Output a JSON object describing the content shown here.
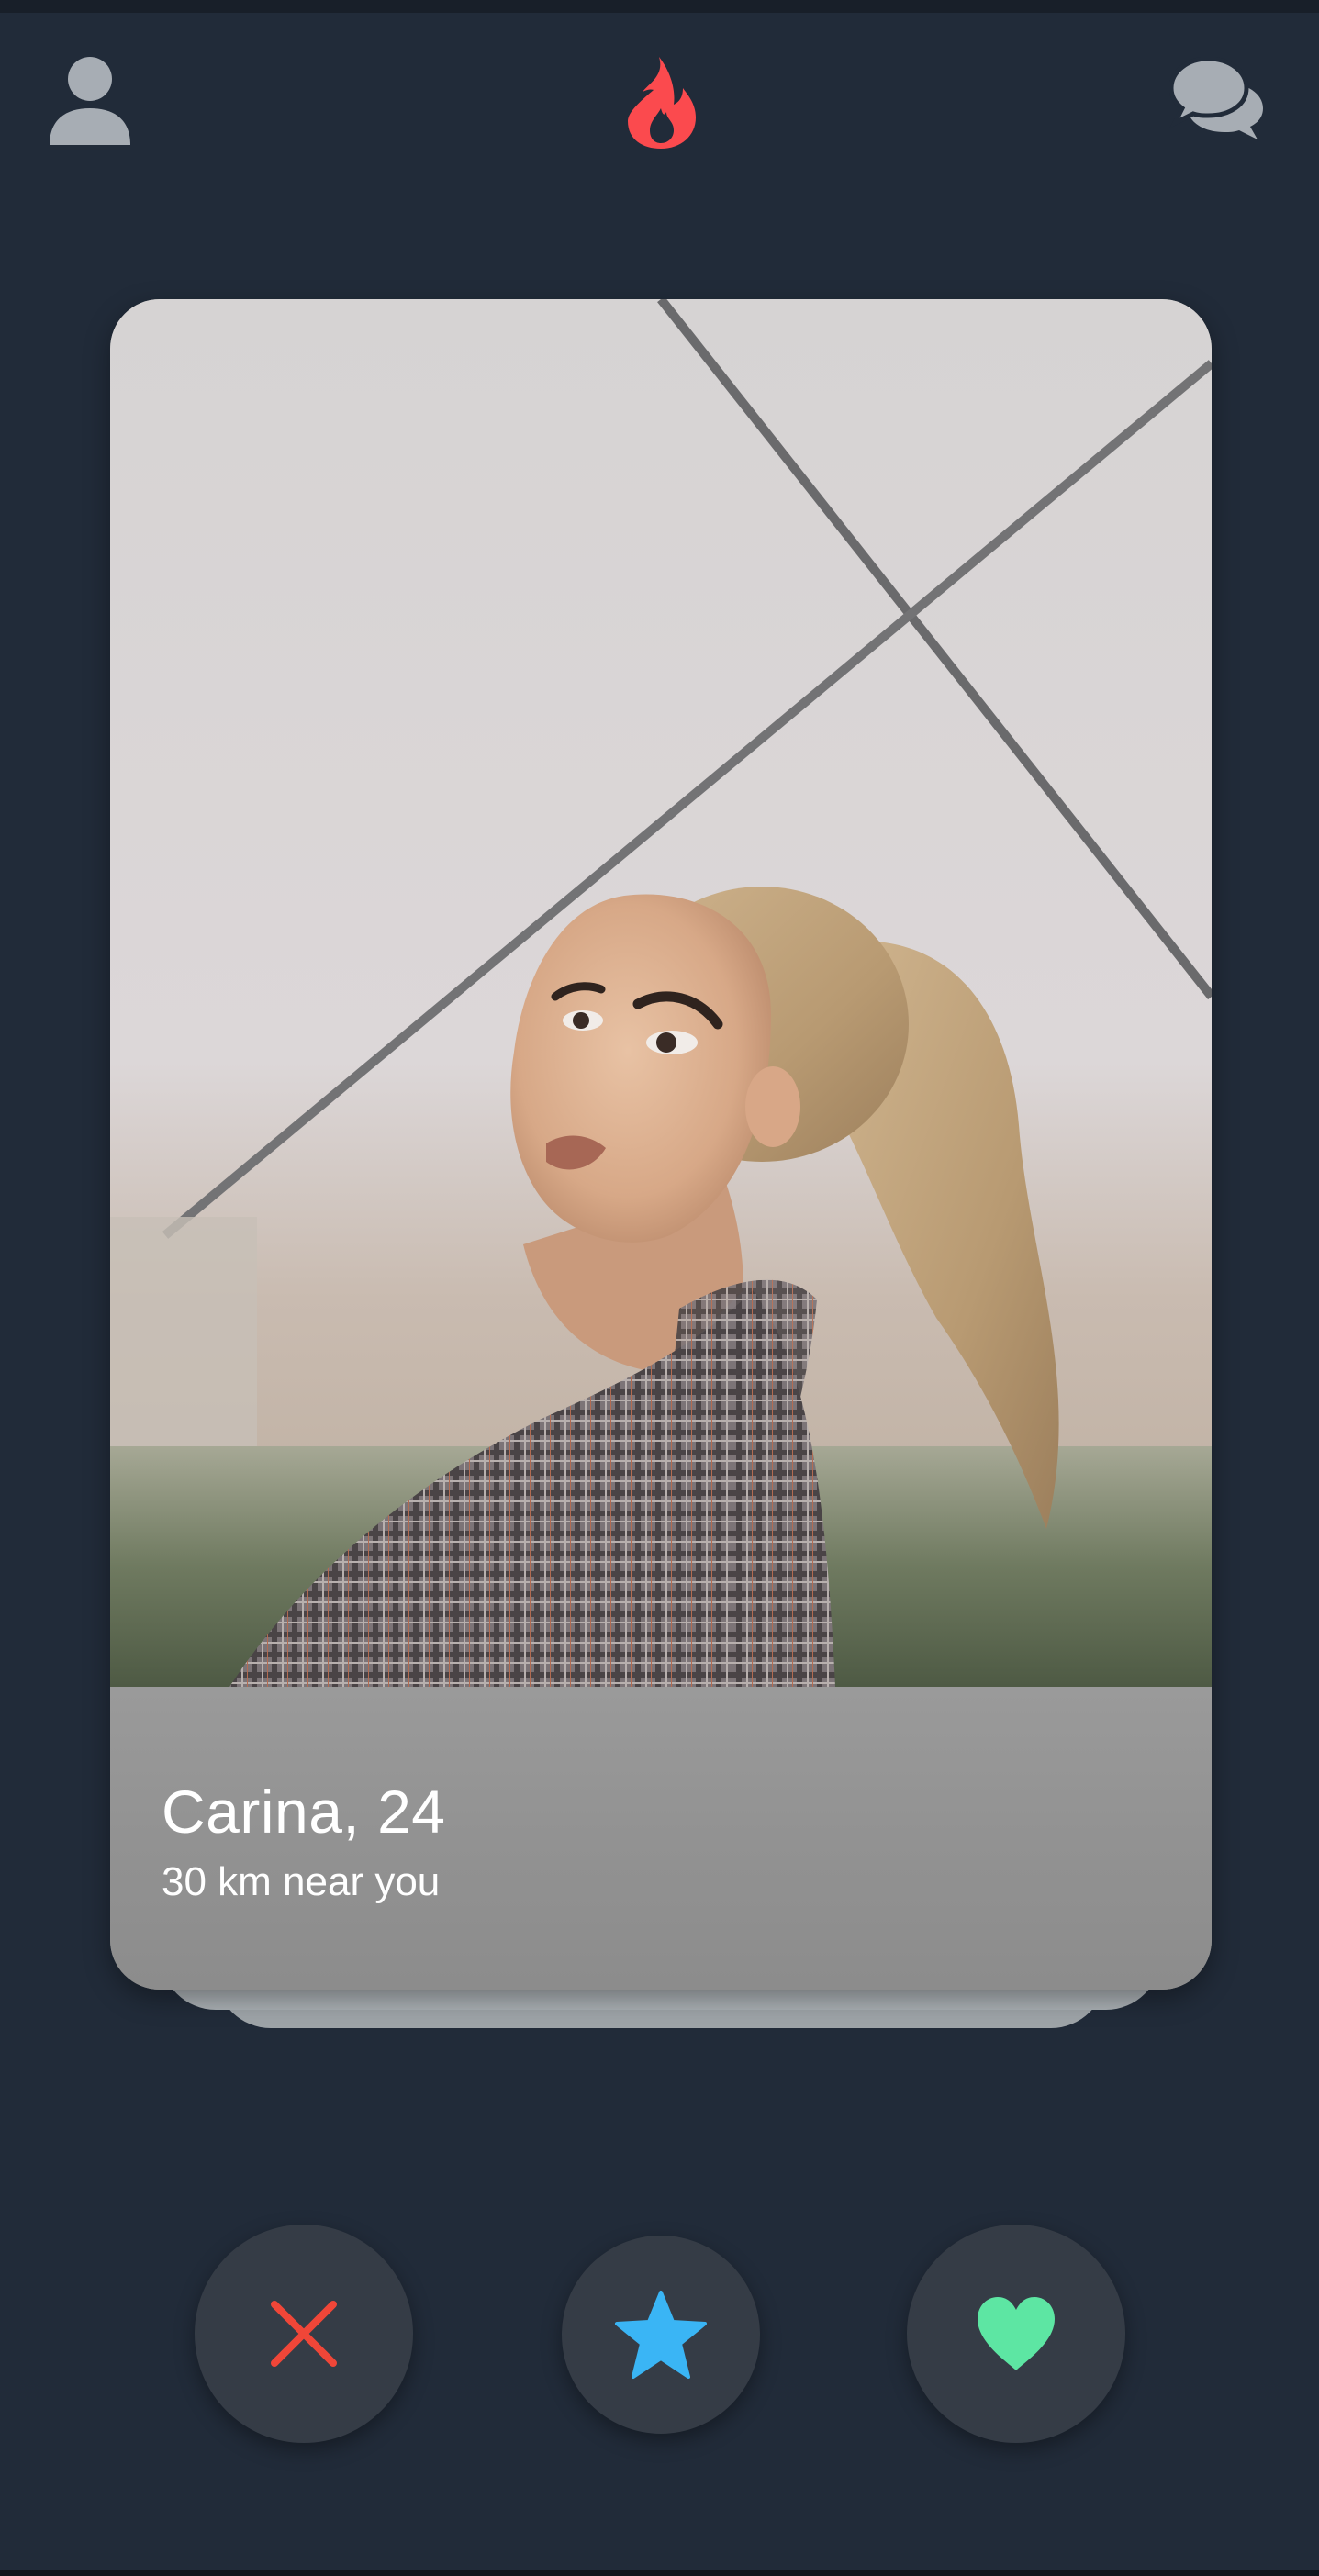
{
  "header": {
    "left_icon": "profile-icon",
    "center_icon": "flame-logo-icon",
    "right_icon": "chat-bubbles-icon"
  },
  "card": {
    "name_age": "Carina, 24",
    "distance": "30 km near you"
  },
  "actions": {
    "dislike_icon": "close-icon",
    "superlike_icon": "star-icon",
    "like_icon": "heart-icon"
  },
  "colors": {
    "background": "#212b39",
    "flame": "#fb4a4e",
    "dislike": "#f04638",
    "superlike": "#3ab5f5",
    "like": "#5de6a3",
    "icon_gray": "#a7adb4"
  }
}
